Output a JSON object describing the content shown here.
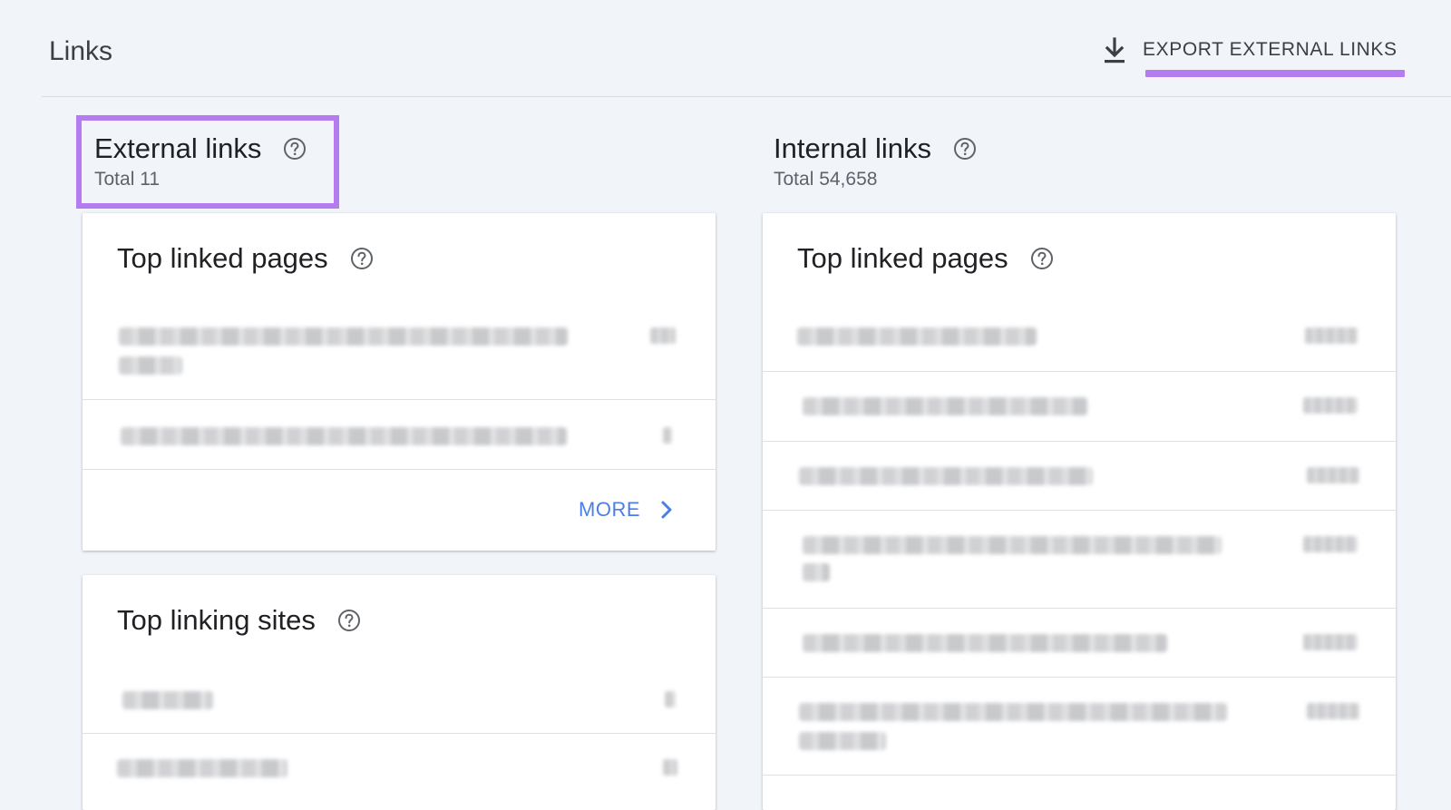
{
  "header": {
    "title": "Links",
    "export_label": "EXPORT EXTERNAL LINKS",
    "export_icon": "download-icon"
  },
  "external": {
    "title": "External links",
    "total": "Total 11",
    "top_linked_pages": {
      "title": "Top linked pages",
      "more_label": "MORE"
    },
    "top_linking_sites": {
      "title": "Top linking sites"
    }
  },
  "internal": {
    "title": "Internal links",
    "total": "Total 54,658",
    "top_linked_pages": {
      "title": "Top linked pages"
    }
  },
  "colors": {
    "background": "#f1f4f9",
    "highlight": "#b57bf1",
    "link_blue": "#4c7ee8"
  }
}
